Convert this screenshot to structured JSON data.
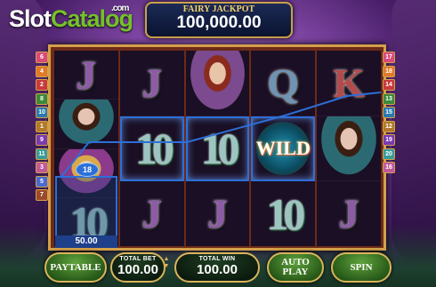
{
  "logo": {
    "part1": "Slot",
    "part2": "Catalog",
    "suffix": ".com"
  },
  "jackpot": {
    "title": "FAIRY JACKPOT",
    "value": "100,000.00"
  },
  "reels": [
    [
      "J",
      "fairy-dark",
      "fairy-blonde",
      "10"
    ],
    [
      "J",
      "10",
      "J"
    ],
    [
      "fairy-red",
      "10",
      "J"
    ],
    [
      "Q",
      "WILD",
      "10"
    ],
    [
      "K",
      "fairy-dark",
      "J"
    ]
  ],
  "symbols": {
    "wild_label": "WILD",
    "ten_label": "10"
  },
  "paylines": {
    "left": [
      "6",
      "4",
      "2",
      "8",
      "10",
      "1",
      "9",
      "11",
      "3",
      "5",
      "7"
    ],
    "right": [
      "17",
      "18",
      "14",
      "13",
      "15",
      "12",
      "19",
      "20",
      "16"
    ],
    "colors": [
      "#d94a7a",
      "#e07a2a",
      "#c93a3a",
      "#3a8a3a",
      "#2a7ab0",
      "#b07a2a",
      "#7a3ab0",
      "#3a9a9a",
      "#c05a9a",
      "#4a6ad0",
      "#9a4a2a"
    ]
  },
  "win": {
    "line_badge": "18",
    "amount": "50.00"
  },
  "controls": {
    "paytable": "PAYTABLE",
    "total_bet_label": "TOTAL BET",
    "total_bet_value": "100.00",
    "total_win_label": "TOTAL WIN",
    "total_win_value": "100.00",
    "autoplay_line1": "AUTO",
    "autoplay_line2": "PLAY",
    "spin": "SPIN"
  }
}
